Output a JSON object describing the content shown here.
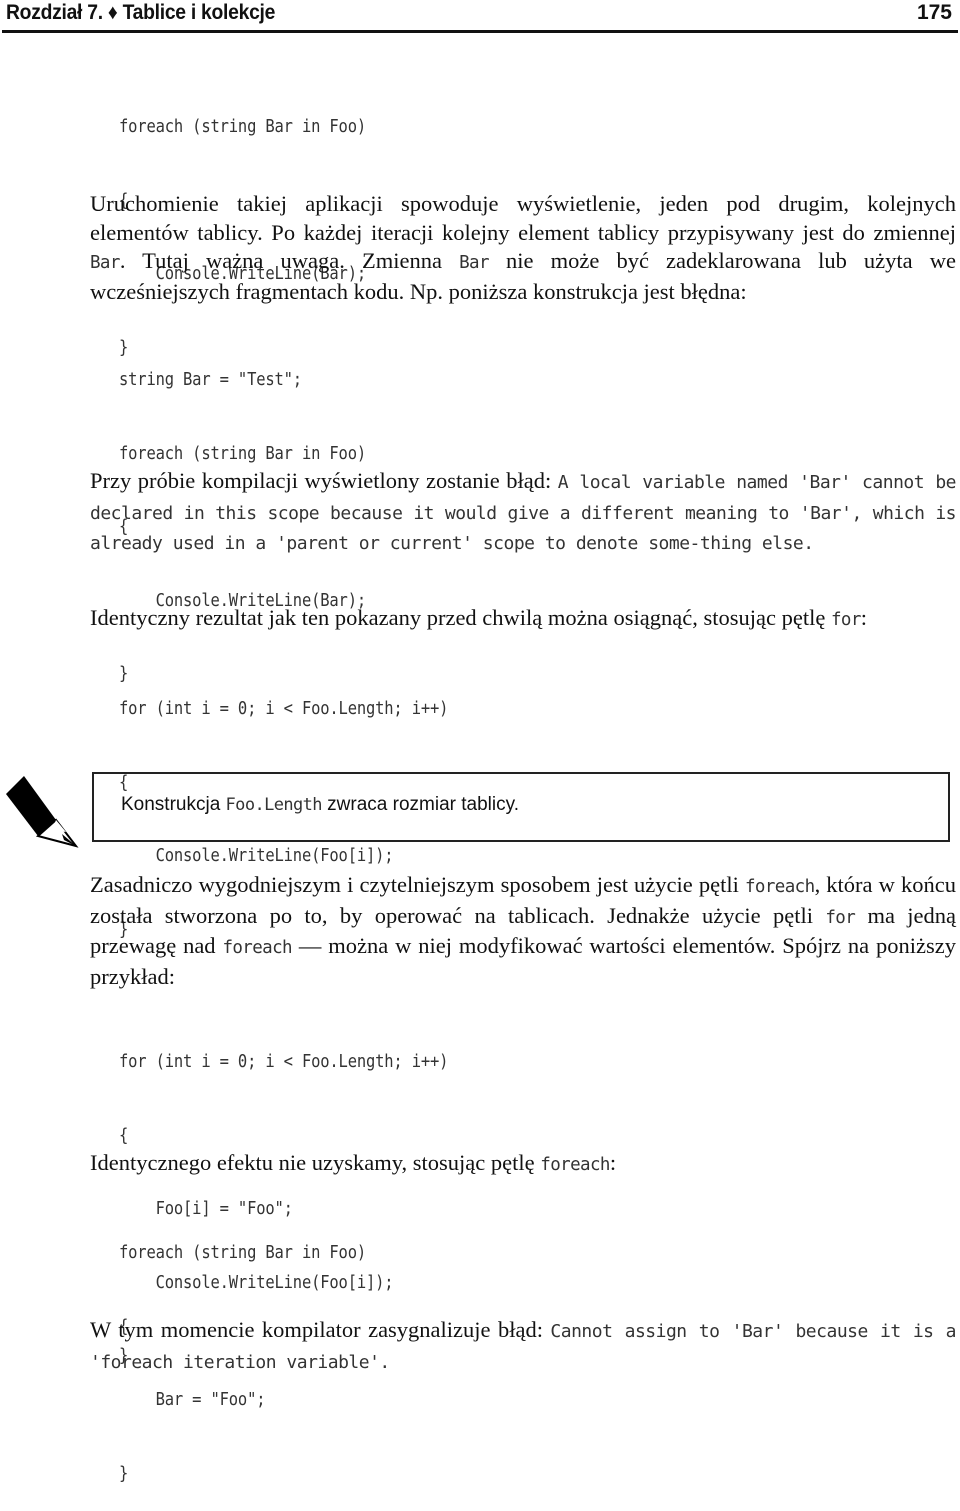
{
  "header": {
    "title": "Rozdział 7. ♦ Tablice i kolekcje",
    "page_number": "175"
  },
  "code1": [
    "foreach (string Bar in Foo)",
    "{",
    "    Console.WriteLine(Bar);",
    "}"
  ],
  "para1": {
    "t1": "Uruchomienie takiej aplikacji spowoduje wyświetlenie, jeden pod drugim, kolejnych elementów tablicy. Po każdej iteracji kolejny element tablicy przypisywany jest do zmiennej ",
    "c1": "Bar",
    "t2": ". Tutaj ważna uwaga. Zmienna ",
    "c2": "Bar",
    "t3": " nie może być zadeklarowana lub użyta we wcześniejszych fragmentach kodu. Np. poniższa konstrukcja jest błędna:"
  },
  "code2": [
    "string Bar = \"Test\";",
    "foreach (string Bar in Foo)",
    "{",
    "    Console.WriteLine(Bar);",
    "}"
  ],
  "para2": {
    "t1": "Przy próbie kompilacji wyświetlony zostanie błąd: ",
    "error": "A local variable named 'Bar' cannot be declared in this scope because it would give a different meaning to 'Bar', which is already used in a 'parent or current' scope to denote some-thing else."
  },
  "para3": {
    "t1": "Identyczny rezultat jak ten pokazany przed chwilą można osiągnąć, stosując pętlę ",
    "c1": "for",
    "t2": ":"
  },
  "code3": [
    "for (int i = 0; i < Foo.Length; i++)",
    "{",
    "    Console.WriteLine(Foo[i]);",
    "}"
  ],
  "note": {
    "icon": "pencil-icon",
    "t1": "Konstrukcja ",
    "c1": "Foo.Length",
    "t2": " zwraca rozmiar tablicy."
  },
  "para4": {
    "t1": "Zasadniczo wygodniejszym i czytelniejszym sposobem jest użycie pętli ",
    "c1": "foreach",
    "t2": ", która w końcu została stworzona po to, by operować na tablicach. Jednakże użycie pętli ",
    "c2": "for",
    "t3": " ma jedną przewagę nad ",
    "c3": "foreach",
    "t4": " — można w niej modyfikować wartości elementów. Spójrz na poniższy przykład:"
  },
  "code4": [
    "for (int i = 0; i < Foo.Length; i++)",
    "{",
    "    Foo[i] = \"Foo\";",
    "    Console.WriteLine(Foo[i]);",
    "}"
  ],
  "para5": {
    "t1": "Identycznego efektu nie uzyskamy, stosując pętlę ",
    "c1": "foreach",
    "t2": ":"
  },
  "code5": [
    "foreach (string Bar in Foo)",
    "{",
    "    Bar = \"Foo\";",
    "}"
  ],
  "para6": {
    "t1": "W tym momencie kompilator zasygnalizuje błąd: ",
    "error": "Cannot assign to 'Bar' because it is a 'foreach iteration variable'."
  }
}
